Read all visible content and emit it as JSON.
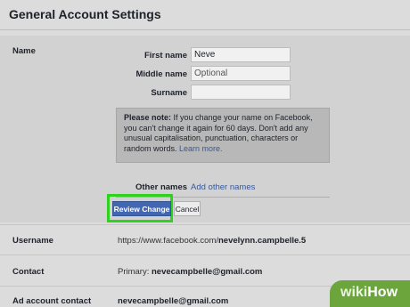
{
  "page": {
    "title": "General Account Settings"
  },
  "name_section": {
    "label": "Name",
    "first_name_label": "First name",
    "first_name_value": "Neve",
    "middle_name_label": "Middle name",
    "middle_name_placeholder": "Optional",
    "surname_label": "Surname",
    "surname_value": "",
    "note_title": "Please note:",
    "note_text": " If you change your name on Facebook, you can't change it again for 60 days. Don't add any unusual capitalisation, punctuation, characters or random words. ",
    "note_link": "Learn more.",
    "other_names_label": "Other names",
    "other_names_link": "Add other names",
    "review_button": "Review Change",
    "cancel_button": "Cancel"
  },
  "username": {
    "label": "Username",
    "url_prefix": "https://www.facebook.com/",
    "url_handle": "nevelynn.campbelle.5"
  },
  "contact": {
    "label": "Contact",
    "prefix": "Primary: ",
    "email": "nevecampbelle@gmail.com"
  },
  "ad_account_contact": {
    "label": "Ad account contact",
    "email": "nevecampbelle@gmail.com"
  },
  "watermark": {
    "part1": "wiki",
    "part2": "How"
  },
  "colors": {
    "primary_button": "#4267b2",
    "link": "#365899",
    "highlight": "#2fd21f",
    "watermark": "#6ba53c"
  }
}
